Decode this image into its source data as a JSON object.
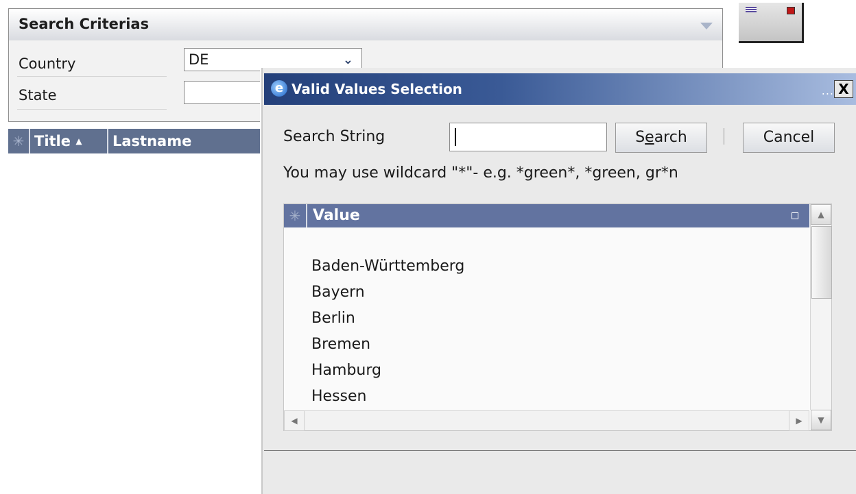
{
  "criteria": {
    "title": "Search Criterias",
    "country_label": "Country",
    "country_value": "DE",
    "state_label": "State",
    "state_value": ""
  },
  "background_table": {
    "columns": [
      "Title",
      "Lastname"
    ],
    "sort_indicator": "▲"
  },
  "dialog": {
    "title": "Valid Values Selection",
    "title_dots": "...",
    "close_label": "X",
    "search_label": "Search String",
    "search_value": "",
    "search_button": "Search",
    "cancel_button": "Cancel",
    "hint": "You may use wildcard \"*\"- e.g. *green*, *green, gr*n",
    "grid": {
      "column": "Value",
      "rows": [
        "Baden-Württemberg",
        "Bayern",
        "Berlin",
        "Bremen",
        "Hamburg",
        "Hessen"
      ]
    }
  },
  "icons": {
    "asterisk": "✳",
    "dropdown": "❯",
    "scroll_up": "▲",
    "scroll_down": "▼",
    "scroll_left": "◀",
    "scroll_right": "▶"
  }
}
